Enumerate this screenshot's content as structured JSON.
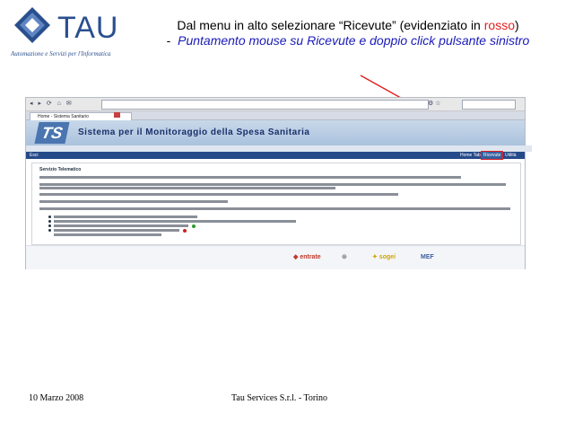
{
  "logo": {
    "name": "TAU",
    "subtitle": "Automazione e Servizi per l'Informatica",
    "brand_color": "#2a4f8f"
  },
  "instruction": {
    "line1_prefix": "Dal menu in alto selezionare “Ricevute” (evidenziato in ",
    "line1_red": "rosso",
    "line1_suffix": ")",
    "line2_dash": "-",
    "line2_italic": "Puntamento mouse su Ricevute e doppio click pulsante sinistro",
    "accent_red": "#e02020",
    "accent_blue": "#1a1ab8"
  },
  "screenshot": {
    "tab_label": "Home - Sistema Sanitario",
    "banner_title": "Sistema per il Monitoraggio della Spesa Sanitaria",
    "menu": {
      "left": "Esci",
      "item1": "Home Tab",
      "item2": "Ricevute",
      "item3": "Utilità"
    },
    "content_title": "Servizio Telematico"
  },
  "footer": {
    "date": "10 Marzo 2008",
    "company": "Tau Services S.r.l. - Torino"
  }
}
